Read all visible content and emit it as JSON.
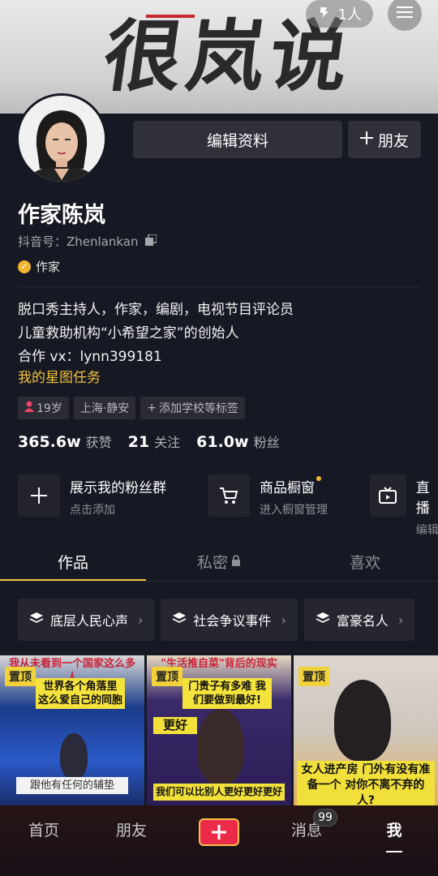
{
  "cover": {
    "title": "很岚说"
  },
  "header": {
    "visitor_count": "1人"
  },
  "actions": {
    "edit_label": "编辑资料",
    "friend_label": "朋友"
  },
  "profile": {
    "nickname": "作家陈岚",
    "douyin_id": "抖音号：Zhenlankan",
    "verify_label": "作家",
    "bio": [
      "脱口秀主持人，作家，编剧，电视节目评论员",
      "儿童救助机构“小希望之家”的创始人",
      "合作 vx：lynn399181"
    ],
    "star_task": "我的星图任务",
    "tags": {
      "age": "19岁",
      "location": "上海·静安",
      "add_school": "添加学校等标签"
    },
    "stats": [
      {
        "num": "365.6w",
        "label": "获赞"
      },
      {
        "num": "21",
        "label": "关注"
      },
      {
        "num": "61.0w",
        "label": "粉丝"
      }
    ]
  },
  "features": [
    {
      "title": "展示我的粉丝群",
      "sub": "点击添加",
      "icon": "plus-icon"
    },
    {
      "title": "商品橱窗",
      "sub": "进入橱窗管理",
      "icon": "cart-icon"
    },
    {
      "title": "直播",
      "sub": "编辑",
      "icon": "tv-icon"
    }
  ],
  "tabs": [
    {
      "label": "作品"
    },
    {
      "label": "私密"
    },
    {
      "label": "喜欢"
    }
  ],
  "collections": [
    {
      "label": "底层人民心声"
    },
    {
      "label": "社会争议事件"
    },
    {
      "label": "富豪名人"
    }
  ],
  "videos": [
    {
      "pinned": "置顶",
      "caption_top": "我从未看到一个国家这么多人",
      "caption_mid": "世界各个角落里 这么爱自己的同胞",
      "caption_bot": "跟他有任何的辅垫"
    },
    {
      "pinned": "置顶",
      "caption_top": "\"生活推自菜\"背后的现实",
      "caption_mid": "门贵子有多难 我们要做到最好!",
      "caption_side": "更好",
      "caption_bot": "我们可以比别人更好更好更好"
    },
    {
      "pinned": "置顶",
      "caption_bot": "女人进产房 门外有没有准备一个 对你不离不弃的人?"
    }
  ],
  "bottom_nav": {
    "home": "首页",
    "friends": "朋友",
    "messages": "消息",
    "me": "我",
    "message_badge": "99"
  },
  "colors": {
    "background": "#161823",
    "accent": "#f2c23d",
    "plus": "#ec2a4a"
  }
}
